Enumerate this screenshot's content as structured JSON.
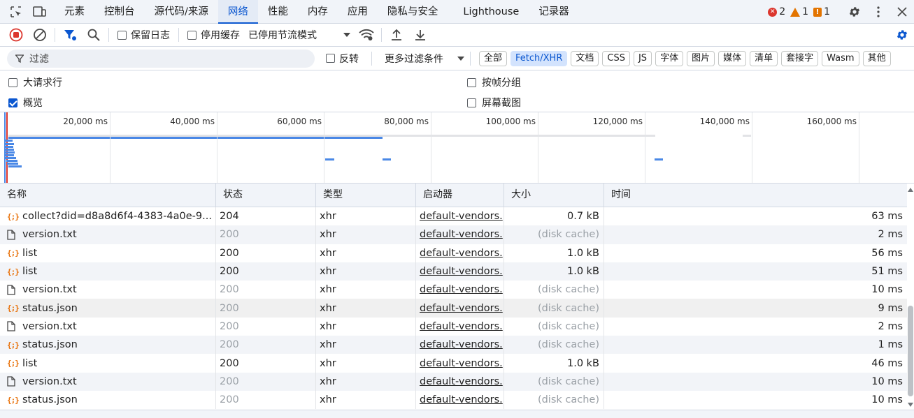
{
  "topbar": {
    "tabs": [
      "元素",
      "控制台",
      "源代码/来源",
      "网络",
      "性能",
      "内存",
      "应用",
      "隐私与安全",
      "Lighthouse",
      "记录器"
    ],
    "active_tab": "网络",
    "errors": "2",
    "warnings": "1",
    "issues": "1"
  },
  "toolbar": {
    "preserve_log": "保留日志",
    "disable_cache": "停用缓存",
    "throttling": "已停用节流模式"
  },
  "filter": {
    "placeholder": "过滤",
    "invert": "反转",
    "more_filters": "更多过滤条件",
    "types": [
      "全部",
      "Fetch/XHR",
      "文档",
      "CSS",
      "JS",
      "字体",
      "图片",
      "媒体",
      "清单",
      "套接字",
      "Wasm",
      "其他"
    ],
    "active_type": "Fetch/XHR"
  },
  "options": {
    "big_rows": "大请求行",
    "group_by_frame": "按帧分组",
    "overview": "概览",
    "screenshots": "屏幕截图"
  },
  "overview": {
    "ticks": [
      "20,000 ms",
      "40,000 ms",
      "60,000 ms",
      "80,000 ms",
      "100,000 ms",
      "120,000 ms",
      "140,000 ms",
      "160,000 ms"
    ]
  },
  "table": {
    "columns": [
      "名称",
      "状态",
      "类型",
      "启动器",
      "大小",
      "时间"
    ],
    "rows": [
      {
        "icon": "xhr",
        "name": "collect?did=d8a8d6f4-4383-4a0e-9...",
        "status": "204",
        "type": "xhr",
        "initiator": "default-vendors.",
        "size": "0.7 kB",
        "time": "63 ms",
        "cached": false
      },
      {
        "icon": "doc",
        "name": "version.txt",
        "status": "200",
        "type": "xhr",
        "initiator": "default-vendors.",
        "size": "(disk cache)",
        "time": "2 ms",
        "cached": true
      },
      {
        "icon": "xhr",
        "name": "list",
        "status": "200",
        "type": "xhr",
        "initiator": "default-vendors.",
        "size": "1.0 kB",
        "time": "56 ms",
        "cached": false
      },
      {
        "icon": "xhr",
        "name": "list",
        "status": "200",
        "type": "xhr",
        "initiator": "default-vendors.",
        "size": "1.0 kB",
        "time": "51 ms",
        "cached": false
      },
      {
        "icon": "doc",
        "name": "version.txt",
        "status": "200",
        "type": "xhr",
        "initiator": "default-vendors.",
        "size": "(disk cache)",
        "time": "10 ms",
        "cached": true
      },
      {
        "icon": "xhr",
        "name": "status.json",
        "status": "200",
        "type": "xhr",
        "initiator": "default-vendors.",
        "size": "(disk cache)",
        "time": "9 ms",
        "cached": true
      },
      {
        "icon": "doc",
        "name": "version.txt",
        "status": "200",
        "type": "xhr",
        "initiator": "default-vendors.",
        "size": "(disk cache)",
        "time": "2 ms",
        "cached": true
      },
      {
        "icon": "xhr",
        "name": "status.json",
        "status": "200",
        "type": "xhr",
        "initiator": "default-vendors.",
        "size": "(disk cache)",
        "time": "1 ms",
        "cached": true
      },
      {
        "icon": "xhr",
        "name": "list",
        "status": "200",
        "type": "xhr",
        "initiator": "default-vendors.",
        "size": "1.0 kB",
        "time": "46 ms",
        "cached": false
      },
      {
        "icon": "doc",
        "name": "version.txt",
        "status": "200",
        "type": "xhr",
        "initiator": "default-vendors.",
        "size": "(disk cache)",
        "time": "10 ms",
        "cached": true
      },
      {
        "icon": "xhr",
        "name": "status.json",
        "status": "200",
        "type": "xhr",
        "initiator": "default-vendors.",
        "size": "(disk cache)",
        "time": "10 ms",
        "cached": true
      }
    ]
  },
  "colors": {
    "accent": "#0b57d0",
    "error": "#dc362e",
    "warning": "#e37400",
    "xhr_icon": "#e8710a"
  }
}
